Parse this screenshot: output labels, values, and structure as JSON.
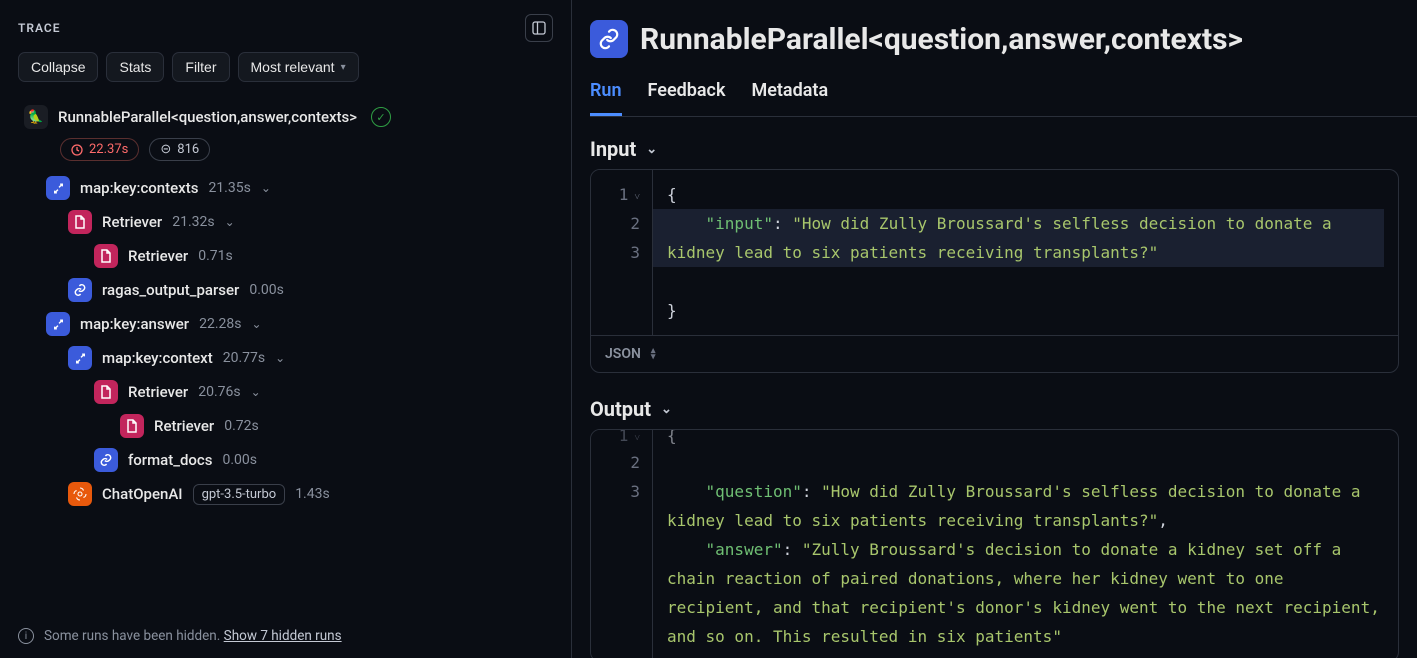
{
  "sidebar": {
    "title": "TRACE",
    "buttons": {
      "collapse": "Collapse",
      "stats": "Stats",
      "filter": "Filter",
      "sort": "Most relevant"
    },
    "root": {
      "label": "RunnableParallel<question,answer,contexts>",
      "duration": "22.37s",
      "tokens": "816"
    },
    "nodes": [
      {
        "id": "ctx",
        "indent": 1,
        "icon": "chain-blue",
        "label": "map:key:contexts",
        "time": "21.35s",
        "expandable": true
      },
      {
        "id": "ret1",
        "indent": 2,
        "icon": "doc-pink",
        "label": "Retriever",
        "time": "21.32s",
        "expandable": true
      },
      {
        "id": "ret1b",
        "indent": 3,
        "icon": "doc-pink",
        "label": "Retriever",
        "time": "0.71s",
        "expandable": false
      },
      {
        "id": "ragas",
        "indent": 2,
        "icon": "link-blue",
        "label": "ragas_output_parser",
        "time": "0.00s",
        "expandable": false
      },
      {
        "id": "ans",
        "indent": 1,
        "icon": "chain-blue",
        "label": "map:key:answer",
        "time": "22.28s",
        "expandable": true
      },
      {
        "id": "ctx2",
        "indent": 2,
        "icon": "chain-blue",
        "label": "map:key:context",
        "time": "20.77s",
        "expandable": true
      },
      {
        "id": "ret2",
        "indent": 3,
        "icon": "doc-pink",
        "label": "Retriever",
        "time": "20.76s",
        "expandable": true
      },
      {
        "id": "ret2b",
        "indent": 4,
        "icon": "doc-pink",
        "label": "Retriever",
        "time": "0.72s",
        "expandable": false
      },
      {
        "id": "fmt",
        "indent": 3,
        "icon": "link-blue",
        "label": "format_docs",
        "time": "0.00s",
        "expandable": false
      },
      {
        "id": "chat",
        "indent": 2,
        "icon": "ai-orange",
        "label": "ChatOpenAI",
        "time": "1.43s",
        "model": "gpt-3.5-turbo",
        "expandable": false
      }
    ],
    "footer": {
      "text": "Some runs have been hidden.",
      "link": "Show 7 hidden runs"
    }
  },
  "detail": {
    "title": "RunnableParallel<question,answer,contexts>",
    "tabs": [
      "Run",
      "Feedback",
      "Metadata"
    ],
    "active_tab": "Run",
    "input": {
      "heading": "Input",
      "format": "JSON",
      "lines": [
        {
          "n": "1",
          "fold": true,
          "html": "{"
        },
        {
          "n": "2",
          "hl": true,
          "key": "input",
          "val": "How did Zully Broussard's selfless decision to donate a kidney lead to six patients receiving transplants?"
        },
        {
          "n": "3",
          "html": "}"
        }
      ]
    },
    "output": {
      "heading": "Output",
      "lines": [
        {
          "n": "1",
          "fold": true,
          "cut": true,
          "html": "{"
        },
        {
          "n": "2",
          "key": "question",
          "val": "How did Zully Broussard's selfless decision to donate a kidney lead to six patients receiving transplants?",
          "trailing_comma": true
        },
        {
          "n": "3",
          "key": "answer",
          "val": "Zully Broussard's decision to donate a kidney set off a chain reaction of paired donations, where her kidney went to one recipient, and that recipient's donor's kidney went to the next recipient, and so on. This resulted in six patients"
        }
      ]
    }
  }
}
